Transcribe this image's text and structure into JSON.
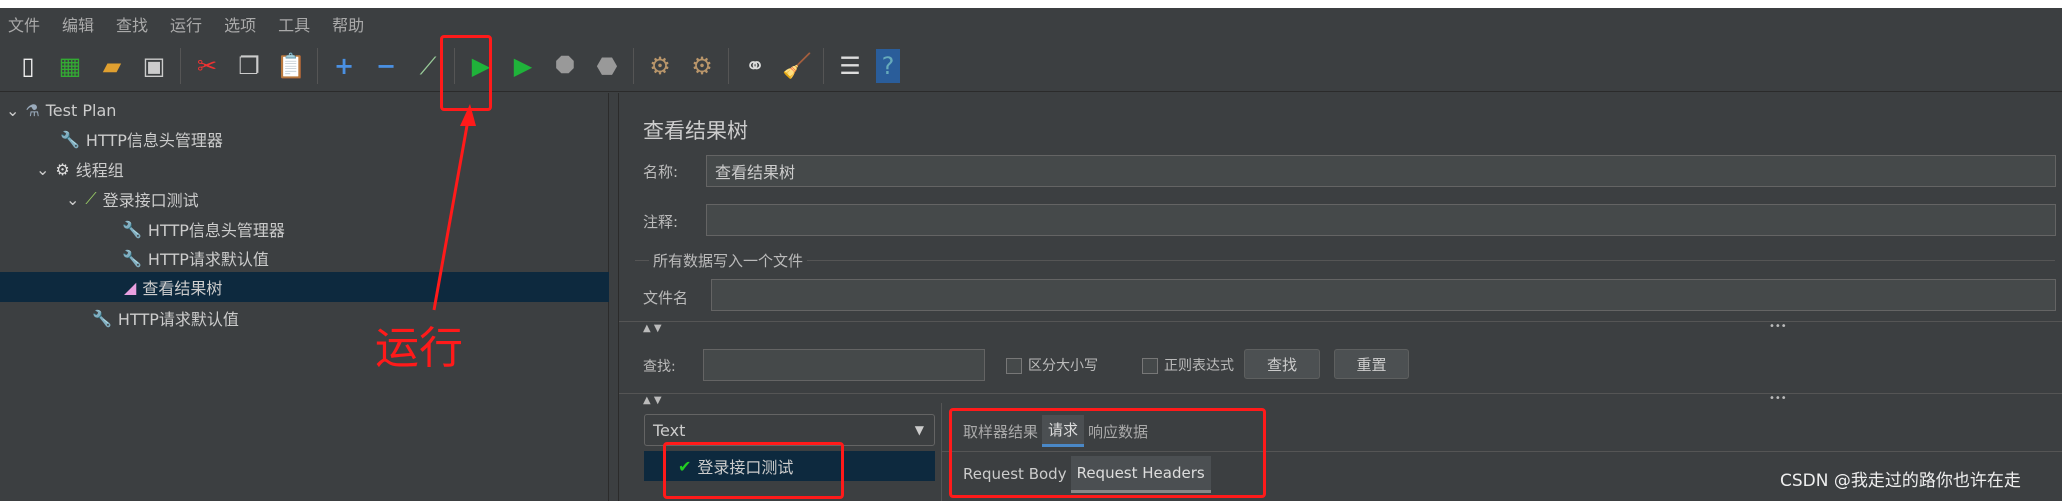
{
  "menu": [
    "文件",
    "编辑",
    "查找",
    "运行",
    "选项",
    "工具",
    "帮助"
  ],
  "toolbar_icons": [
    "new-icon",
    "templates-icon",
    "open-icon",
    "save-icon",
    "cut-icon",
    "copy-icon",
    "paste-icon",
    "expand-icon",
    "collapse-icon",
    "toggle-icon",
    "start-icon",
    "start-no-pause-icon",
    "stop-icon",
    "shutdown-icon",
    "clear-icon",
    "clear-all-icon",
    "search-icon",
    "reset-search-icon",
    "function-helper-icon",
    "help-icon"
  ],
  "tree": [
    {
      "label": "Test Plan",
      "icon": "flask-icon"
    },
    {
      "label": "HTTP信息头管理器",
      "icon": "wrench-icon"
    },
    {
      "label": "线程组",
      "icon": "gear-icon"
    },
    {
      "label": "登录接口测试",
      "icon": "pipette-icon"
    },
    {
      "label": "HTTP信息头管理器",
      "icon": "wrench-icon"
    },
    {
      "label": "HTTP请求默认值",
      "icon": "wrench-icon"
    },
    {
      "label": "查看结果树",
      "icon": "chart-icon"
    },
    {
      "label": "HTTP请求默认值",
      "icon": "wrench-icon"
    }
  ],
  "panel": {
    "title": "查看结果树",
    "name_label": "名称:",
    "name_value": "查看结果树",
    "comment_label": "注释:",
    "comment_value": "",
    "file_group": "所有数据写入一个文件",
    "file_label": "文件名",
    "file_value": "",
    "search_label": "查找:",
    "search_value": "",
    "case_label": "区分大小写",
    "regex_label": "正则表达式",
    "find_button": "查找",
    "reset_button": "重置",
    "renderer": "Text",
    "result_item": "登录接口测试",
    "tabs": [
      "取样器结果",
      "请求",
      "响应数据"
    ],
    "active_tab": "请求",
    "subtabs": [
      "Request Body",
      "Request Headers"
    ],
    "active_subtab": "Request Headers"
  },
  "annotation": {
    "run_text": "运行",
    "color": "#ff1a1a"
  },
  "watermark": "CSDN @我走过的路你也许在走"
}
